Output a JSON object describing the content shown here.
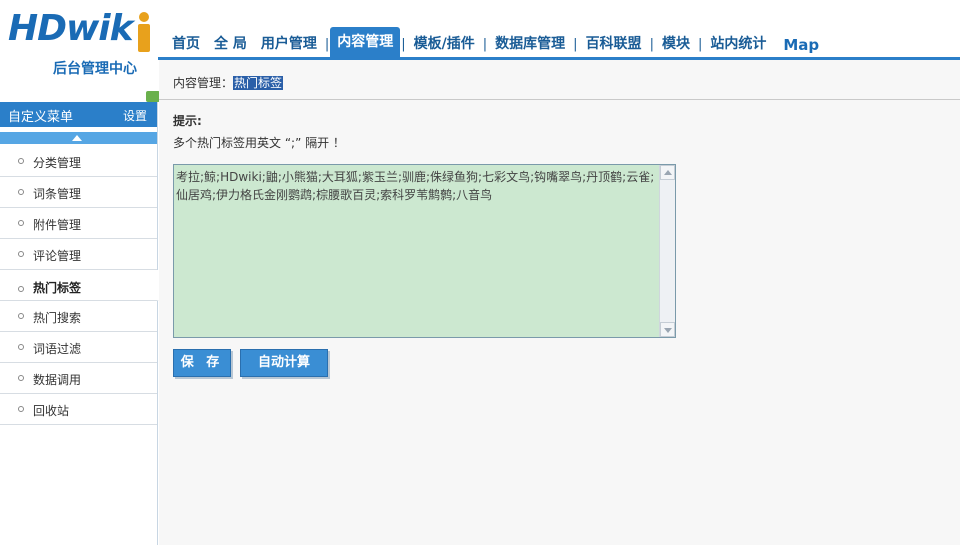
{
  "logo": {
    "text": "HDwik",
    "subtitle": "后台管理中心"
  },
  "nav": {
    "items": [
      {
        "label": "首页",
        "active": false
      },
      {
        "label": "全 局",
        "active": false
      },
      {
        "label": "用户管理",
        "active": false
      },
      {
        "label": "内容管理",
        "active": true
      },
      {
        "label": "模板/插件",
        "active": false
      },
      {
        "label": "数据库管理",
        "active": false
      },
      {
        "label": "百科联盟",
        "active": false
      },
      {
        "label": "模块",
        "active": false
      },
      {
        "label": "站内统计",
        "active": false
      }
    ],
    "separator": "|",
    "map": "Map"
  },
  "sidebar": {
    "title": "自定义菜单",
    "setting": "设置",
    "items": [
      {
        "label": "分类管理"
      },
      {
        "label": "词条管理"
      },
      {
        "label": "附件管理"
      },
      {
        "label": "评论管理"
      },
      {
        "label": "热门标签",
        "active": true
      },
      {
        "label": "热门搜索"
      },
      {
        "label": "词语过滤"
      },
      {
        "label": "数据调用"
      },
      {
        "label": "回收站"
      }
    ]
  },
  "main": {
    "breadcrumb_prefix": "内容管理：",
    "breadcrumb_current": "热门标签",
    "hint_title": "提示:",
    "hint_text": "多个热门标签用英文 “;” 隔开 ！",
    "tags_value": "考拉;鲸;HDwiki;鼬;小熊猫;大耳狐;紫玉兰;驯鹿;侏绿鱼狗;七彩文鸟;钩嘴翠鸟;丹顶鹤;云雀;仙居鸡;伊力格氏金刚鹦鹉;棕腰歌百灵;索科罗苇鹪鹩;八音鸟",
    "save_label": "保 存",
    "auto_label": "自动计算"
  },
  "colors": {
    "accent": "#2b7fc9",
    "textarea_bg": "#cce8d0"
  }
}
